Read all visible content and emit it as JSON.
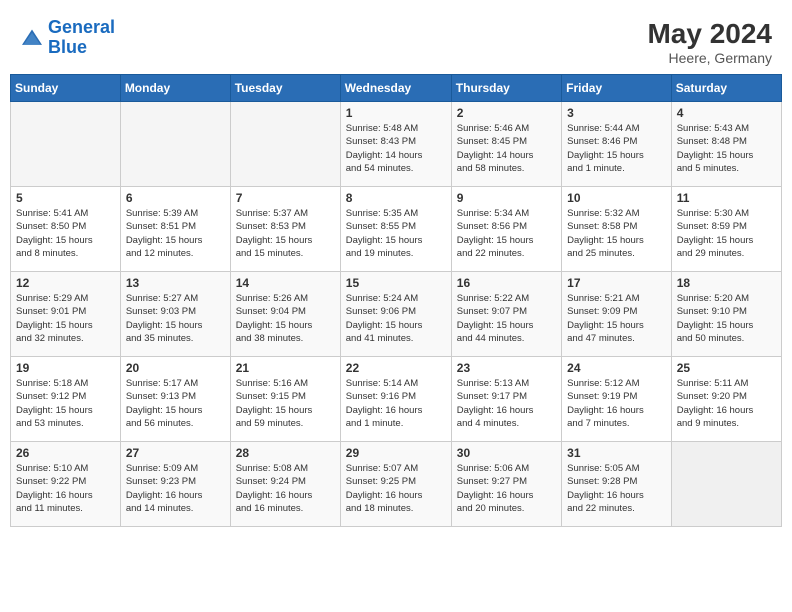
{
  "header": {
    "logo_line1": "General",
    "logo_line2": "Blue",
    "month_year": "May 2024",
    "location": "Heere, Germany"
  },
  "days_of_week": [
    "Sunday",
    "Monday",
    "Tuesday",
    "Wednesday",
    "Thursday",
    "Friday",
    "Saturday"
  ],
  "weeks": [
    [
      {
        "day": "",
        "content": ""
      },
      {
        "day": "",
        "content": ""
      },
      {
        "day": "",
        "content": ""
      },
      {
        "day": "1",
        "content": "Sunrise: 5:48 AM\nSunset: 8:43 PM\nDaylight: 14 hours\nand 54 minutes."
      },
      {
        "day": "2",
        "content": "Sunrise: 5:46 AM\nSunset: 8:45 PM\nDaylight: 14 hours\nand 58 minutes."
      },
      {
        "day": "3",
        "content": "Sunrise: 5:44 AM\nSunset: 8:46 PM\nDaylight: 15 hours\nand 1 minute."
      },
      {
        "day": "4",
        "content": "Sunrise: 5:43 AM\nSunset: 8:48 PM\nDaylight: 15 hours\nand 5 minutes."
      }
    ],
    [
      {
        "day": "5",
        "content": "Sunrise: 5:41 AM\nSunset: 8:50 PM\nDaylight: 15 hours\nand 8 minutes."
      },
      {
        "day": "6",
        "content": "Sunrise: 5:39 AM\nSunset: 8:51 PM\nDaylight: 15 hours\nand 12 minutes."
      },
      {
        "day": "7",
        "content": "Sunrise: 5:37 AM\nSunset: 8:53 PM\nDaylight: 15 hours\nand 15 minutes."
      },
      {
        "day": "8",
        "content": "Sunrise: 5:35 AM\nSunset: 8:55 PM\nDaylight: 15 hours\nand 19 minutes."
      },
      {
        "day": "9",
        "content": "Sunrise: 5:34 AM\nSunset: 8:56 PM\nDaylight: 15 hours\nand 22 minutes."
      },
      {
        "day": "10",
        "content": "Sunrise: 5:32 AM\nSunset: 8:58 PM\nDaylight: 15 hours\nand 25 minutes."
      },
      {
        "day": "11",
        "content": "Sunrise: 5:30 AM\nSunset: 8:59 PM\nDaylight: 15 hours\nand 29 minutes."
      }
    ],
    [
      {
        "day": "12",
        "content": "Sunrise: 5:29 AM\nSunset: 9:01 PM\nDaylight: 15 hours\nand 32 minutes."
      },
      {
        "day": "13",
        "content": "Sunrise: 5:27 AM\nSunset: 9:03 PM\nDaylight: 15 hours\nand 35 minutes."
      },
      {
        "day": "14",
        "content": "Sunrise: 5:26 AM\nSunset: 9:04 PM\nDaylight: 15 hours\nand 38 minutes."
      },
      {
        "day": "15",
        "content": "Sunrise: 5:24 AM\nSunset: 9:06 PM\nDaylight: 15 hours\nand 41 minutes."
      },
      {
        "day": "16",
        "content": "Sunrise: 5:22 AM\nSunset: 9:07 PM\nDaylight: 15 hours\nand 44 minutes."
      },
      {
        "day": "17",
        "content": "Sunrise: 5:21 AM\nSunset: 9:09 PM\nDaylight: 15 hours\nand 47 minutes."
      },
      {
        "day": "18",
        "content": "Sunrise: 5:20 AM\nSunset: 9:10 PM\nDaylight: 15 hours\nand 50 minutes."
      }
    ],
    [
      {
        "day": "19",
        "content": "Sunrise: 5:18 AM\nSunset: 9:12 PM\nDaylight: 15 hours\nand 53 minutes."
      },
      {
        "day": "20",
        "content": "Sunrise: 5:17 AM\nSunset: 9:13 PM\nDaylight: 15 hours\nand 56 minutes."
      },
      {
        "day": "21",
        "content": "Sunrise: 5:16 AM\nSunset: 9:15 PM\nDaylight: 15 hours\nand 59 minutes."
      },
      {
        "day": "22",
        "content": "Sunrise: 5:14 AM\nSunset: 9:16 PM\nDaylight: 16 hours\nand 1 minute."
      },
      {
        "day": "23",
        "content": "Sunrise: 5:13 AM\nSunset: 9:17 PM\nDaylight: 16 hours\nand 4 minutes."
      },
      {
        "day": "24",
        "content": "Sunrise: 5:12 AM\nSunset: 9:19 PM\nDaylight: 16 hours\nand 7 minutes."
      },
      {
        "day": "25",
        "content": "Sunrise: 5:11 AM\nSunset: 9:20 PM\nDaylight: 16 hours\nand 9 minutes."
      }
    ],
    [
      {
        "day": "26",
        "content": "Sunrise: 5:10 AM\nSunset: 9:22 PM\nDaylight: 16 hours\nand 11 minutes."
      },
      {
        "day": "27",
        "content": "Sunrise: 5:09 AM\nSunset: 9:23 PM\nDaylight: 16 hours\nand 14 minutes."
      },
      {
        "day": "28",
        "content": "Sunrise: 5:08 AM\nSunset: 9:24 PM\nDaylight: 16 hours\nand 16 minutes."
      },
      {
        "day": "29",
        "content": "Sunrise: 5:07 AM\nSunset: 9:25 PM\nDaylight: 16 hours\nand 18 minutes."
      },
      {
        "day": "30",
        "content": "Sunrise: 5:06 AM\nSunset: 9:27 PM\nDaylight: 16 hours\nand 20 minutes."
      },
      {
        "day": "31",
        "content": "Sunrise: 5:05 AM\nSunset: 9:28 PM\nDaylight: 16 hours\nand 22 minutes."
      },
      {
        "day": "",
        "content": ""
      }
    ]
  ]
}
